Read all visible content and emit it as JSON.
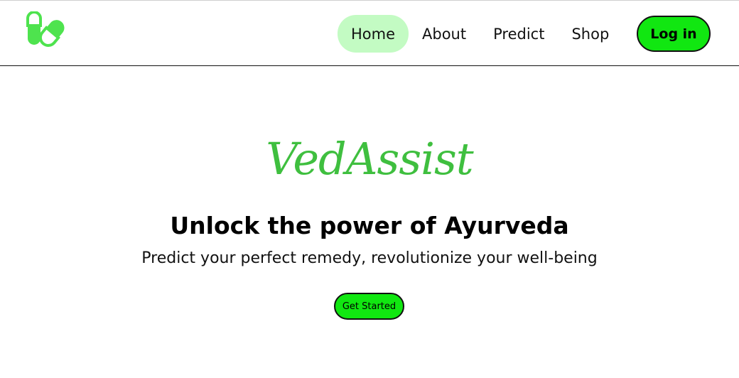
{
  "navbar": {
    "logo_icon": "pill-heart-icon",
    "links": [
      {
        "label": "Home",
        "active": true
      },
      {
        "label": "About"
      },
      {
        "label": "Predict"
      },
      {
        "label": "Shop"
      }
    ],
    "login_label": "Log in"
  },
  "hero": {
    "brand": "VedAssist",
    "headline": "Unlock the power of Ayurveda",
    "subheadline": "Predict your perfect remedy, revolutionize your well-being",
    "cta_label": "Get Started"
  },
  "colors": {
    "accent": "#11e711",
    "active_link_bg": "#c3fbc3",
    "brand_text": "#3fbf3f"
  }
}
